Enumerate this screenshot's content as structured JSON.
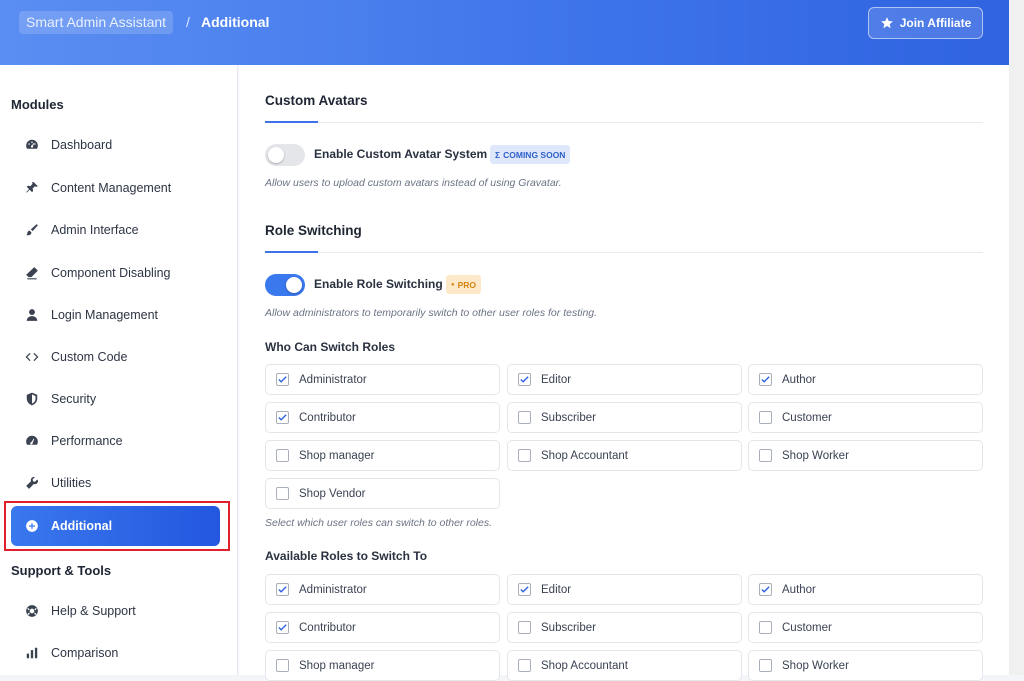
{
  "header": {
    "app_name": "Smart Admin Assistant",
    "separator": "/",
    "current_page": "Additional",
    "affiliate_label": "Join Affiliate"
  },
  "sidebar": {
    "modules_title": "Modules",
    "modules": [
      {
        "label": "Dashboard",
        "icon": "gauge-icon"
      },
      {
        "label": "Content Management",
        "icon": "pin-icon"
      },
      {
        "label": "Admin Interface",
        "icon": "paintbrush-icon"
      },
      {
        "label": "Component Disabling",
        "icon": "eraser-icon"
      },
      {
        "label": "Login Management",
        "icon": "user-icon"
      },
      {
        "label": "Custom Code",
        "icon": "code-icon"
      },
      {
        "label": "Security",
        "icon": "shield-icon"
      },
      {
        "label": "Performance",
        "icon": "speedometer-icon"
      },
      {
        "label": "Utilities",
        "icon": "wrench-icon"
      },
      {
        "label": "Additional",
        "icon": "plus-circle-icon",
        "active": true
      }
    ],
    "support_title": "Support & Tools",
    "support": [
      {
        "label": "Help & Support",
        "icon": "lifebuoy-icon"
      },
      {
        "label": "Comparison",
        "icon": "bar-chart-icon"
      }
    ]
  },
  "main": {
    "avatars": {
      "title": "Custom Avatars",
      "toggle_label": "Enable Custom Avatar System",
      "toggle_on": false,
      "badge": "COMING SOON",
      "badge_glyph": "Σ",
      "hint": "Allow users to upload custom avatars instead of using Gravatar."
    },
    "role_switching": {
      "title": "Role Switching",
      "toggle_label": "Enable Role Switching",
      "toggle_on": true,
      "badge": "PRO",
      "badge_glyph": "●",
      "hint": "Allow administrators to temporarily switch to other user roles for testing.",
      "who_title": "Who Can Switch Roles",
      "who_roles": [
        {
          "label": "Administrator",
          "checked": true
        },
        {
          "label": "Editor",
          "checked": true
        },
        {
          "label": "Author",
          "checked": true
        },
        {
          "label": "Contributor",
          "checked": true
        },
        {
          "label": "Subscriber",
          "checked": false
        },
        {
          "label": "Customer",
          "checked": false
        },
        {
          "label": "Shop manager",
          "checked": false
        },
        {
          "label": "Shop Accountant",
          "checked": false
        },
        {
          "label": "Shop Worker",
          "checked": false
        },
        {
          "label": "Shop Vendor",
          "checked": false
        }
      ],
      "who_hint": "Select which user roles can switch to other roles.",
      "available_title": "Available Roles to Switch To",
      "available_roles": [
        {
          "label": "Administrator",
          "checked": true
        },
        {
          "label": "Editor",
          "checked": true
        },
        {
          "label": "Author",
          "checked": true
        },
        {
          "label": "Contributor",
          "checked": true
        },
        {
          "label": "Subscriber",
          "checked": false
        },
        {
          "label": "Customer",
          "checked": false
        },
        {
          "label": "Shop manager",
          "checked": false
        },
        {
          "label": "Shop Accountant",
          "checked": false
        },
        {
          "label": "Shop Worker",
          "checked": false
        }
      ]
    }
  },
  "colors": {
    "accent": "#3a78ee",
    "header_gradient_start": "#5b8ef2",
    "header_gradient_end": "#2f63e0",
    "highlight_red": "#e0202a",
    "pro_badge": "#d48512"
  }
}
